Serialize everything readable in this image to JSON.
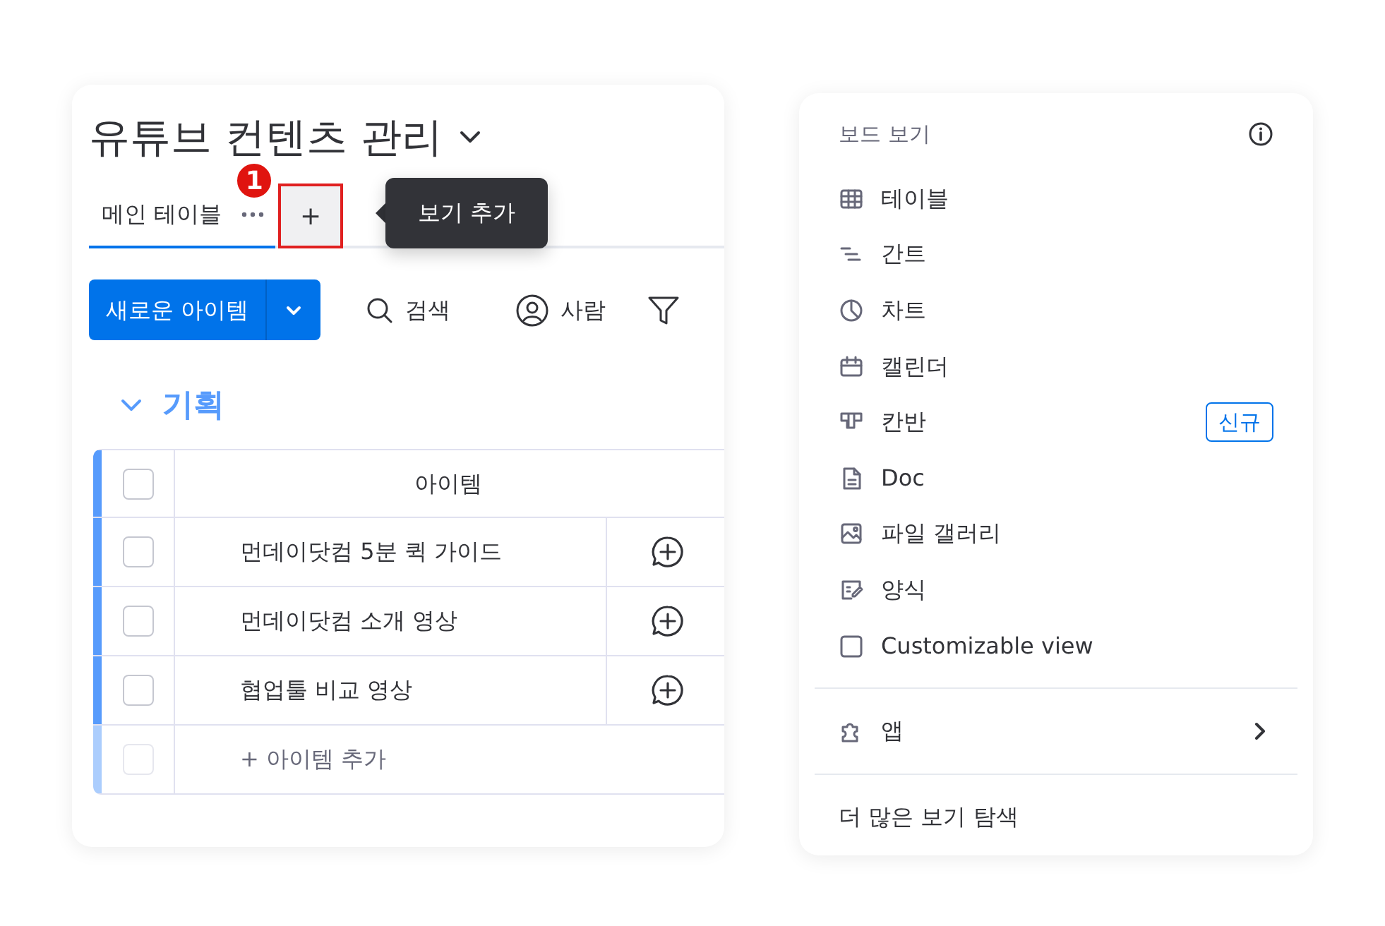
{
  "board": {
    "title": "유튜브 컨텐츠 관리",
    "tabs": [
      {
        "label": "메인 테이블",
        "selected": true
      }
    ],
    "add_view_button": {
      "label": "+",
      "highlighted": true
    },
    "step_badge": "1",
    "tooltip": "보기 추가",
    "toolbar": {
      "new_item": "새로운 아이템",
      "search": "검색",
      "person": "사람"
    },
    "group": {
      "title": "기획",
      "color": "#579bfc",
      "column": "아이템",
      "header_checked": false,
      "rows": [
        {
          "name": "먼데이닷컴 5분 퀵 가이드",
          "checked": false
        },
        {
          "name": "먼데이닷컴 소개 영상",
          "checked": false
        },
        {
          "name": "협업툴 비교 영상",
          "checked": false
        }
      ],
      "add_item": "+ 아이템 추가",
      "add_item_checked": false
    }
  },
  "menu": {
    "title": "보드 보기",
    "items": [
      {
        "kind": "table",
        "label": "테이블"
      },
      {
        "kind": "gantt",
        "label": "간트"
      },
      {
        "kind": "chart",
        "label": "차트"
      },
      {
        "kind": "calendar",
        "label": "캘린더"
      },
      {
        "kind": "kanban",
        "label": "칸반",
        "badge": "신규"
      },
      {
        "kind": "doc",
        "label": "Doc"
      },
      {
        "kind": "gallery",
        "label": "파일 갤러리"
      },
      {
        "kind": "form",
        "label": "양식"
      },
      {
        "kind": "custom",
        "label": "Customizable view"
      }
    ],
    "apps": "앱",
    "explore": "더 많은 보기 탐색"
  }
}
